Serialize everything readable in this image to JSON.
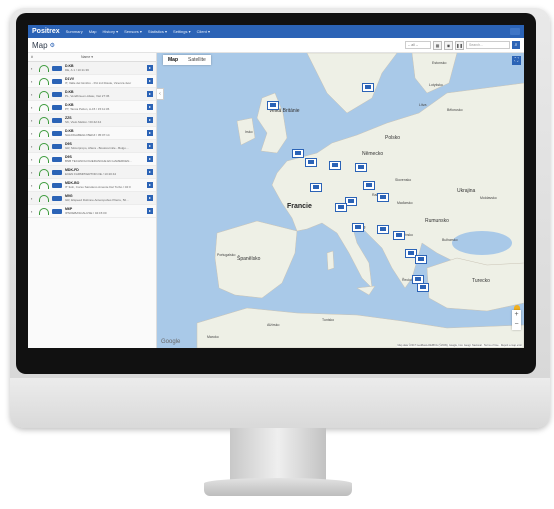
{
  "app": {
    "logo": "Positrex",
    "nav": [
      "Summary",
      "Map",
      "History ▾",
      "Sensors ▾",
      "Statistics ▾",
      "Settings ▾",
      "Client ▾"
    ]
  },
  "page": {
    "title": "Map",
    "select_value": "-- all --",
    "search_placeholder": "Search..."
  },
  "vehicles": {
    "columns": [
      "#",
      "",
      "",
      "Name ▾"
    ],
    "rows": [
      {
        "name": "D.KB",
        "desc": "DE, A 1 / 10:11:36"
      },
      {
        "name": "D1VV",
        "desc": "IT, Valle del Isimbro - Pol ind Roiole, Vicenza 4ver"
      },
      {
        "name": "D.KB",
        "desc": "PL, Vendbra-en-Alsau, Viel 27:36"
      },
      {
        "name": "D.KB",
        "desc": "PT, Tanca Pelton, A-15 / 15:11:36"
      },
      {
        "name": "ZZS",
        "desc": "SK, Vielo Mellon / 00:42:44"
      },
      {
        "name": "D.KB",
        "desc": "SALDIGABEGIJ BEKZ / 05:07:14"
      },
      {
        "name": "D9S",
        "desc": "GR, Motorpropo, Aftera - Bostorermile - Bulgo…"
      },
      {
        "name": "D9S",
        "desc": "BNB TECHNOLOGIERANCHE EN HAMERKEN…"
      },
      {
        "name": "MDK-FD",
        "desc": "ECEN FARMPFERTOR.OE / 10:20:44"
      },
      {
        "name": "MDK-BO",
        "desc": "IT 3oln, Corso Sarsdeno Amente Del Turbo / 02:0"
      },
      {
        "name": "M9G",
        "desc": "GR, Elspeed Dolimne Anteropubus Pilerre, 50…"
      },
      {
        "name": "M6P",
        "desc": "IPNOEBASCALUSE / 04:15:00"
      }
    ]
  },
  "map": {
    "tabs": [
      "Map",
      "Satellite"
    ],
    "labels": [
      {
        "text": "Estonsko",
        "size": "small"
      },
      {
        "text": "Lotyšsko",
        "size": "small"
      },
      {
        "text": "Litva",
        "size": "small"
      },
      {
        "text": "Bělorusko",
        "size": "small"
      },
      {
        "text": "Velká Británie",
        "size": "normal"
      },
      {
        "text": "Irsko",
        "size": "small"
      },
      {
        "text": "Polsko",
        "size": "normal"
      },
      {
        "text": "Německo",
        "size": "normal"
      },
      {
        "text": "Česko",
        "size": "small"
      },
      {
        "text": "Slovensko",
        "size": "small"
      },
      {
        "text": "Ukrajina",
        "size": "normal"
      },
      {
        "text": "Moldavsko",
        "size": "small"
      },
      {
        "text": "Francie",
        "size": "big"
      },
      {
        "text": "Rakousko",
        "size": "small"
      },
      {
        "text": "Maďarsko",
        "size": "small"
      },
      {
        "text": "Rumunsko",
        "size": "normal"
      },
      {
        "text": "Itálie",
        "size": "normal"
      },
      {
        "text": "Srbsko",
        "size": "small"
      },
      {
        "text": "Bulharsko",
        "size": "small"
      },
      {
        "text": "Portugalsko",
        "size": "small"
      },
      {
        "text": "Španělsko",
        "size": "normal"
      },
      {
        "text": "Řecko",
        "size": "small"
      },
      {
        "text": "Turecko",
        "size": "normal"
      },
      {
        "text": "Alžírsko",
        "size": "small"
      },
      {
        "text": "Tunisko",
        "size": "small"
      },
      {
        "text": "Maroko",
        "size": "small"
      }
    ],
    "google": "Google",
    "attribution": "Map data ©2017 GeoBasis-DE/BKG (©2009), Google, Inst. Geogr. Nacional · Terms of Use · Report a map error"
  },
  "colors": {
    "brand": "#2b63b6",
    "water": "#a9c9e8",
    "land": "#eef0e6"
  }
}
